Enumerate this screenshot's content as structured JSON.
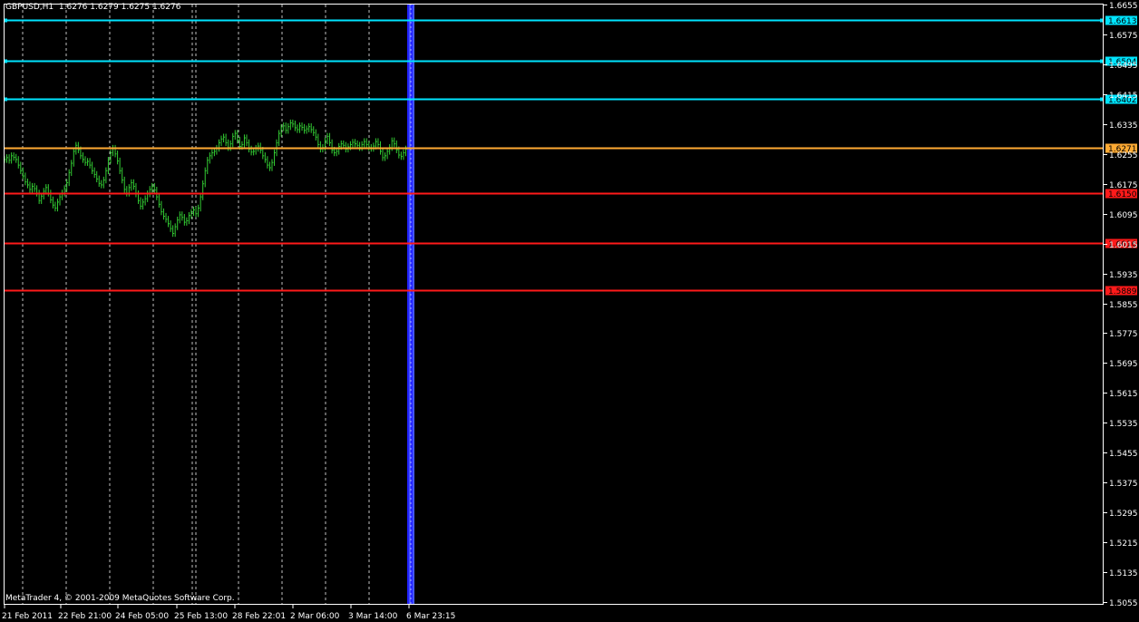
{
  "header": {
    "symbol": "GBPUSD,H1",
    "ohlc": "1.6276 1.6279 1.6275 1.6276"
  },
  "footer": {
    "copyright": "MetaTrader 4, © 2001-2009 MetaQuotes Software Corp."
  },
  "colors": {
    "background": "#000000",
    "frame": "#ffffff",
    "grid": "#ffffff",
    "candles": "#33cc33",
    "resistance": "#00e5ff",
    "pivot": "#ffaa33",
    "support": "#ff1a1a",
    "period_separator": "#2222ff"
  },
  "chart_data": {
    "type": "line",
    "symbol": "GBPUSD",
    "timeframe": "H1",
    "grid": true,
    "y_axis": {
      "position": "right",
      "ylim": [
        1.5055,
        1.6655
      ],
      "ticks": [
        "1.6655",
        "1.6575",
        "1.6495",
        "1.6415",
        "1.6335",
        "1.6255",
        "1.6175",
        "1.6095",
        "1.6015",
        "1.5935",
        "1.5855",
        "1.5775",
        "1.5695",
        "1.5615",
        "1.5535",
        "1.5455",
        "1.5375",
        "1.5295",
        "1.5215",
        "1.5135",
        "1.5055"
      ]
    },
    "x_axis": {
      "ticks": [
        "21 Feb 2011",
        "22 Feb 21:00",
        "24 Feb 05:00",
        "25 Feb 13:00",
        "28 Feb 22:01",
        "2 Mar 06:00",
        "3 Mar 14:00",
        "6 Mar 23:15"
      ]
    },
    "horizontal_lines": [
      {
        "label": "1.6613",
        "value": 1.6613,
        "role": "resistance"
      },
      {
        "label": "1.6504",
        "value": 1.6504,
        "role": "resistance"
      },
      {
        "label": "1.6402",
        "value": 1.6402,
        "role": "resistance"
      },
      {
        "label": "1.6271",
        "value": 1.6271,
        "role": "pivot"
      },
      {
        "label": "1.6150",
        "value": 1.615,
        "role": "support"
      },
      {
        "label": "1.6016",
        "value": 1.6016,
        "role": "support"
      },
      {
        "label": "1.5889",
        "value": 1.5889,
        "role": "support"
      }
    ],
    "price_trace": [
      1.624,
      1.6245,
      1.6238,
      1.625,
      1.6246,
      1.624,
      1.6225,
      1.621,
      1.6196,
      1.618,
      1.6172,
      1.616,
      1.6168,
      1.6162,
      1.615,
      1.613,
      1.6142,
      1.6155,
      1.6165,
      1.615,
      1.6132,
      1.6118,
      1.611,
      1.6126,
      1.614,
      1.615,
      1.6162,
      1.6178,
      1.6205,
      1.623,
      1.6262,
      1.6278,
      1.6266,
      1.625,
      1.624,
      1.6232,
      1.6235,
      1.6225,
      1.621,
      1.62,
      1.6188,
      1.6176,
      1.6172,
      1.6185,
      1.621,
      1.6238,
      1.6258,
      1.627,
      1.6255,
      1.6236,
      1.621,
      1.6185,
      1.616,
      1.615,
      1.6165,
      1.6178,
      1.6168,
      1.6148,
      1.613,
      1.6115,
      1.6126,
      1.6135,
      1.6148,
      1.616,
      1.6168,
      1.6158,
      1.614,
      1.612,
      1.61,
      1.6088,
      1.608,
      1.6068,
      1.6055,
      1.6042,
      1.606,
      1.6078,
      1.6092,
      1.6085,
      1.6072,
      1.6076,
      1.609,
      1.6098,
      1.6105,
      1.6095,
      1.611,
      1.614,
      1.6175,
      1.621,
      1.6238,
      1.625,
      1.6258,
      1.6262,
      1.627,
      1.6285,
      1.6295,
      1.63,
      1.6285,
      1.6272,
      1.6282,
      1.6302,
      1.631,
      1.6292,
      1.6275,
      1.628,
      1.6298,
      1.6285,
      1.6268,
      1.626,
      1.6262,
      1.627,
      1.6276,
      1.6265,
      1.625,
      1.624,
      1.6225,
      1.6218,
      1.6232,
      1.6258,
      1.6285,
      1.631,
      1.6325,
      1.633,
      1.6318,
      1.6328,
      1.6338,
      1.6335,
      1.6325,
      1.632,
      1.633,
      1.6326,
      1.6318,
      1.6322,
      1.6328,
      1.632,
      1.6312,
      1.63,
      1.628,
      1.6268,
      1.6272,
      1.629,
      1.6302,
      1.6285,
      1.6265,
      1.6258,
      1.6262,
      1.6275,
      1.6282,
      1.6278,
      1.6268,
      1.6274,
      1.628,
      1.6286,
      1.6282,
      1.6278,
      1.6272,
      1.628,
      1.6288,
      1.628,
      1.6272,
      1.627,
      1.6276,
      1.6288,
      1.628,
      1.6262,
      1.6245,
      1.625,
      1.6262,
      1.6272,
      1.629,
      1.6282,
      1.6266,
      1.6252,
      1.6248,
      1.6258,
      1.6268,
      1.6276
    ]
  }
}
